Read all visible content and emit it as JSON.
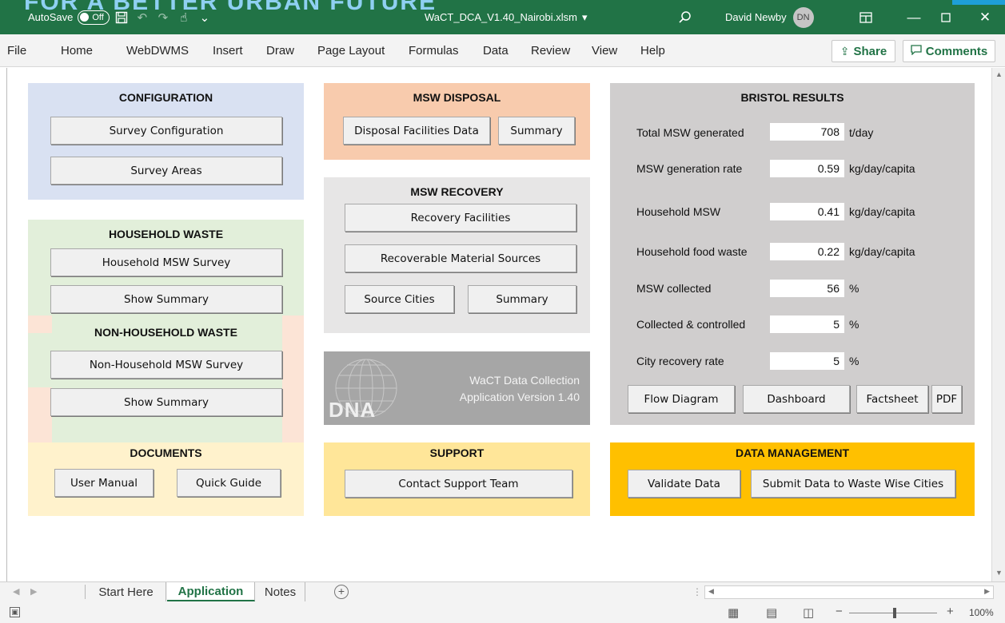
{
  "titlebar": {
    "banner_text": "FOR A BETTER URBAN FUTURE",
    "autosave_label": "AutoSave",
    "autosave_state": "Off",
    "filename": "WaCT_DCA_V1.40_Nairobi.xlsm",
    "filename_caret": "▾",
    "user_name": "David Newby",
    "user_initials": "DN"
  },
  "menu": {
    "items": [
      "File",
      "Home",
      "WebDWMS",
      "Insert",
      "Draw",
      "Page Layout",
      "Formulas",
      "Data",
      "Review",
      "View",
      "Help"
    ],
    "share_label": "Share",
    "comments_label": "Comments"
  },
  "configuration": {
    "title": "CONFIGURATION",
    "survey_configuration": "Survey Configuration",
    "survey_areas": "Survey Areas"
  },
  "household": {
    "title": "HOUSEHOLD WASTE",
    "survey": "Household MSW Survey",
    "summary": "Show Summary"
  },
  "non_household": {
    "title": "NON-HOUSEHOLD WASTE",
    "survey": "Non-Household MSW Survey",
    "summary": "Show Summary"
  },
  "documents": {
    "title": "DOCUMENTS",
    "user_manual": "User Manual",
    "quick_guide": "Quick Guide"
  },
  "disposal": {
    "title": "MSW DISPOSAL",
    "facilities": "Disposal Facilities Data",
    "summary": "Summary"
  },
  "recovery": {
    "title": "MSW RECOVERY",
    "facilities": "Recovery Facilities",
    "material_sources": "Recoverable Material Sources",
    "source_cities": "Source Cities",
    "summary": "Summary"
  },
  "about": {
    "line1": "WaCT Data Collection",
    "line2": "Application Version 1.40",
    "logo_text": "DNA"
  },
  "support": {
    "title": "SUPPORT",
    "contact": "Contact Support Team"
  },
  "results": {
    "title": "BRISTOL RESULTS",
    "rows": [
      {
        "label": "Total MSW generated",
        "value": "708",
        "unit": "t/day"
      },
      {
        "label": "MSW generation rate",
        "value": "0.59",
        "unit": "kg/day/capita"
      },
      {
        "label": "Household MSW",
        "value": "0.41",
        "unit": "kg/day/capita"
      },
      {
        "label": "Household food waste",
        "value": "0.22",
        "unit": "kg/day/capita"
      },
      {
        "label": "MSW collected",
        "value": "56",
        "unit": "%"
      },
      {
        "label": "Collected & controlled",
        "value": "5",
        "unit": "%"
      },
      {
        "label": "City recovery rate",
        "value": "5",
        "unit": "%"
      }
    ],
    "flow_diagram": "Flow Diagram",
    "dashboard": "Dashboard",
    "factsheet": "Factsheet",
    "pdf": "PDF"
  },
  "data_management": {
    "title": "DATA MANAGEMENT",
    "validate": "Validate Data",
    "submit": "Submit Data to Waste Wise Cities"
  },
  "sheet_tabs": [
    "Start Here",
    "Application",
    "Notes"
  ],
  "statusbar": {
    "zoom": "100%"
  },
  "colors": {
    "excel_green": "#217346",
    "config_bg": "#d9e1f2",
    "household_bg": "#e2efda",
    "nonhousehold_side": "#fce4d6",
    "disposal_bg": "#f8cbad",
    "recovery_bg": "#e7e6e6",
    "about_bg": "#a6a6a6",
    "results_bg": "#d0cece",
    "documents_bg": "#fff2cc",
    "support_bg": "#ffe699",
    "datamgmt_bg": "#ffc000"
  }
}
